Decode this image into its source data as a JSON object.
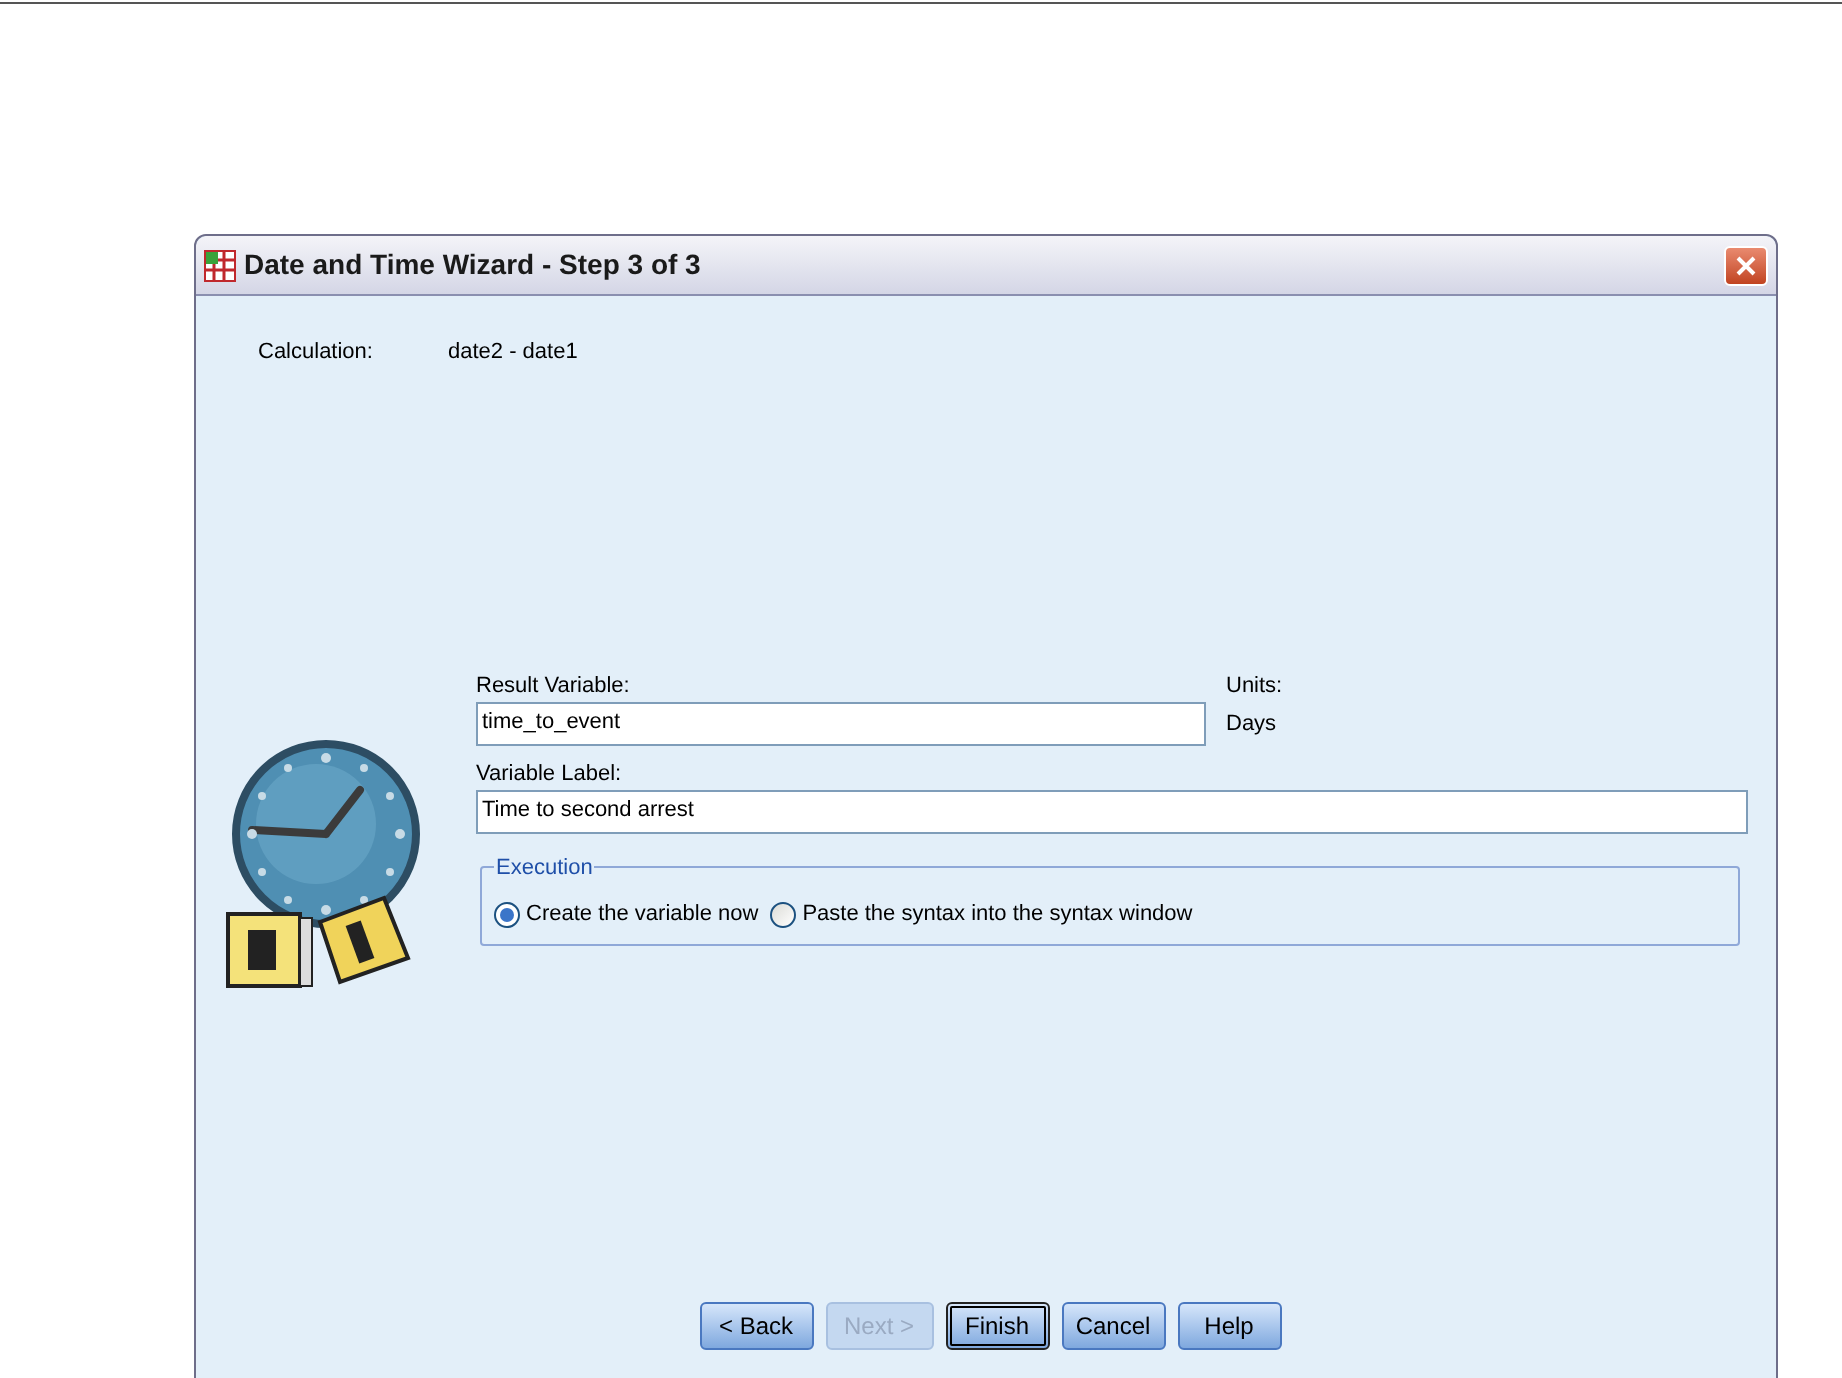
{
  "window": {
    "title": "Date and Time Wizard - Step 3 of 3"
  },
  "calculation": {
    "label": "Calculation:",
    "value": "date2 - date1"
  },
  "result_variable": {
    "label": "Result Variable:",
    "value": "time_to_event"
  },
  "units": {
    "label": "Units:",
    "value": "Days"
  },
  "variable_label": {
    "label": "Variable Label:",
    "value": "Time to second arrest"
  },
  "execution": {
    "title": "Execution",
    "options": [
      {
        "label": "Create the variable now",
        "selected": true
      },
      {
        "label": "Paste the syntax into the syntax window",
        "selected": false
      }
    ]
  },
  "buttons": [
    {
      "label": "< Back",
      "disabled": false,
      "default": false
    },
    {
      "label": "Next >",
      "disabled": true,
      "default": false
    },
    {
      "label": "Finish",
      "disabled": false,
      "default": true
    },
    {
      "label": "Cancel",
      "disabled": false,
      "default": false
    },
    {
      "label": "Help",
      "disabled": false,
      "default": false
    }
  ]
}
